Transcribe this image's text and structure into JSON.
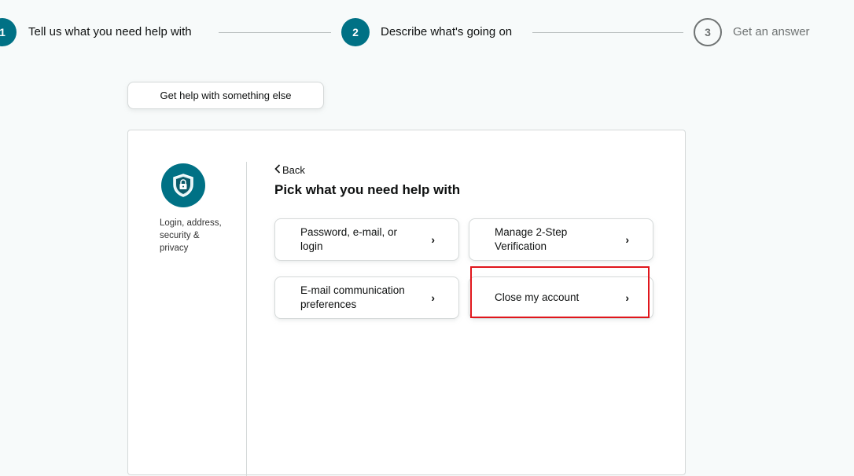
{
  "stepper": {
    "steps": [
      {
        "number": "1",
        "label": "Tell us what you need help with"
      },
      {
        "number": "2",
        "label": "Describe what's going on"
      },
      {
        "number": "3",
        "label": "Get an answer"
      }
    ]
  },
  "else_button": {
    "label": "Get help with something else"
  },
  "category": {
    "icon": "shield-lock-icon",
    "label": "Login, address, security & privacy"
  },
  "panel": {
    "back_label": "Back",
    "title": "Pick what you need help with",
    "options": [
      {
        "label": "Password, e-mail, or login"
      },
      {
        "label": "Manage 2-Step Verification"
      },
      {
        "label": "E-mail communication preferences"
      },
      {
        "label": "Close my account"
      }
    ]
  },
  "colors": {
    "accent": "#007185",
    "highlight": "#e0161c"
  }
}
